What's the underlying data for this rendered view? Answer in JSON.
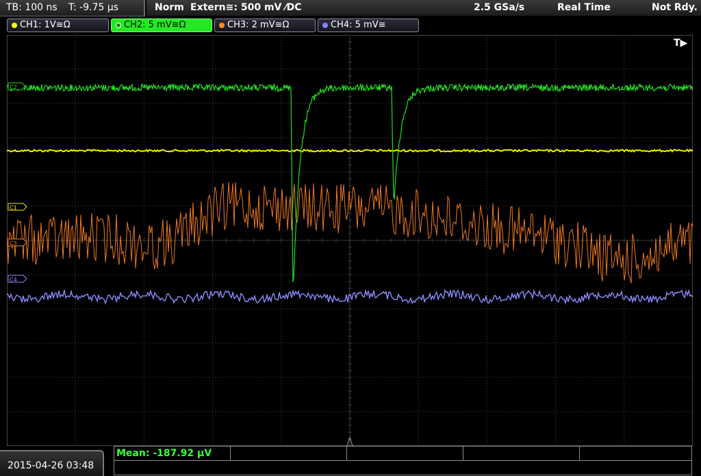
{
  "status": {
    "timebase": "TB: 100 ns",
    "trigger_time": "T: -9.75 µs",
    "mode": "Norm",
    "trigger_source": "Extern≅: 500 mV ⁄DC",
    "sample_rate": "2.5 GSa/s",
    "acq_mode": "Real Time",
    "state": "Not Rdy."
  },
  "channels": [
    {
      "label": "CH1: 1V≅Ω",
      "color": "#ffff00",
      "marker": "C1"
    },
    {
      "label": "CH2: 5 mV≅Ω",
      "color": "#00ff00",
      "marker": "C2",
      "active": true
    },
    {
      "label": "CH3: 2 mV≅Ω",
      "color": "#ff8c1a",
      "marker": "C3"
    },
    {
      "label": "CH4: 5 mV≅",
      "color": "#8080ff",
      "marker": "C4"
    }
  ],
  "trigger_marker": "T▶",
  "timestamp": "2015-04-26 03:48",
  "measurement": {
    "mean": "Mean: -187.92 µV"
  },
  "colors": {
    "ch1": "#f0f000",
    "ch2": "#22dd22",
    "ch3": "#f07a20",
    "ch4": "#8c8cff",
    "grid": "#4a4a4a"
  }
}
